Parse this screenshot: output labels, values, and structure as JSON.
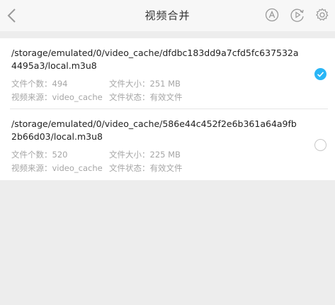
{
  "header": {
    "title": "视频合并",
    "icons": [
      "back-icon",
      "auto-icon",
      "play-icon",
      "settings-icon"
    ]
  },
  "accent_color": "#29b6f6",
  "items": [
    {
      "path": "/storage/emulated/0/video_cache/dfdbc183dd9a7cfd5fc637532a4495a3/local.m3u8",
      "count": "文件个数：494",
      "size": "文件大小：251 MB",
      "source": "视频来源：video_cache",
      "state": "文件状态：有效文件",
      "selected": true
    },
    {
      "path": "/storage/emulated/0/video_cache/586e44c452f2e6b361a64a9fb2b66d03/local.m3u8",
      "count": "文件个数：520",
      "size": "文件大小：225 MB",
      "source": "视频来源：video_cache",
      "state": "文件状态：有效文件",
      "selected": false
    }
  ]
}
